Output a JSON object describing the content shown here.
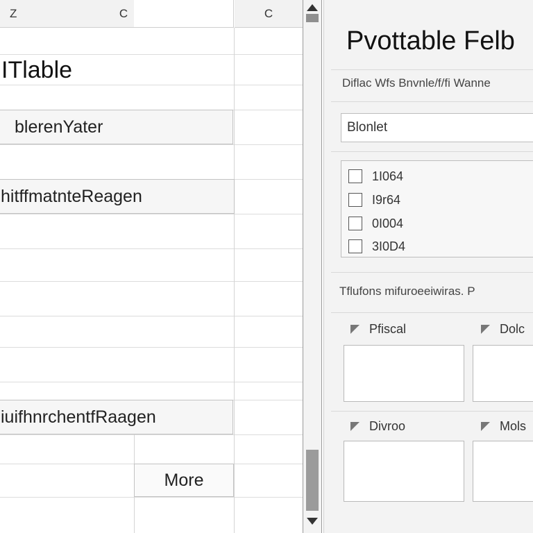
{
  "sheet": {
    "columns": [
      "Z",
      "C",
      "C"
    ],
    "title": "ITlable",
    "buttons": {
      "b1": "blerenYater",
      "b2": "hitffmatnteReagen",
      "b3": "iuifhnrchentfRaagen",
      "more": "More"
    }
  },
  "pane": {
    "title": "Pvottable Felb",
    "subtitle": "Diflac Wfs Bnvnle/f/fi Wanne",
    "search_value": "Blonlet",
    "fields": [
      "1I064",
      "I9r64",
      "0I004",
      "3I0D4"
    ],
    "drag_hint": "Tflufons mifuroeeiwiras. P",
    "areas": {
      "filters": "Pfiscal",
      "columns": "Dolc",
      "rows": "Divroo",
      "values": "Mols"
    }
  }
}
